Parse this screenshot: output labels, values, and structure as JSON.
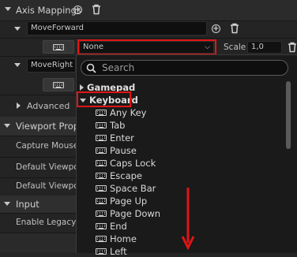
{
  "axis_mappings": {
    "label": "Axis Mappings",
    "mappings": [
      {
        "name": "MoveForward",
        "key_value": "None",
        "scale_label": "Scale",
        "scale_value": "1,0"
      },
      {
        "name": "MoveRight"
      }
    ]
  },
  "advanced_label": "Advanced",
  "viewport_section": {
    "label": "Viewport Propert",
    "rows": [
      "Capture Mouse o",
      "Default Viewport",
      "Default Viewport"
    ]
  },
  "input_section": {
    "label": "Input",
    "rows": [
      "Enable Legacy In"
    ]
  },
  "key_dropdown": {
    "search_placeholder": "Search",
    "categories": {
      "gamepad": "Gamepad",
      "keyboard": "Keyboard"
    },
    "keys": [
      "Any Key",
      "Tab",
      "Enter",
      "Pause",
      "Caps Lock",
      "Escape",
      "Space Bar",
      "Page Up",
      "Page Down",
      "End",
      "Home",
      "Left"
    ]
  },
  "colors": {
    "highlight": "#e01515",
    "panel_bg": "#242424",
    "dropdown_bg": "#1a1a1a"
  }
}
